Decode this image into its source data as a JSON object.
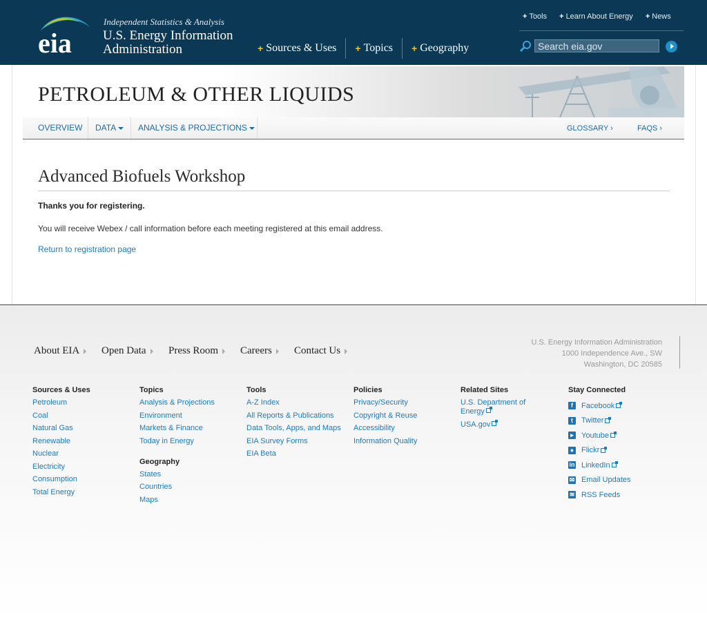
{
  "header": {
    "logo_text": "eia",
    "tagline": "Independent Statistics & Analysis",
    "agency_line1": "U.S. Energy Information",
    "agency_line2": "Administration",
    "main_nav": [
      {
        "label": "Sources & Uses"
      },
      {
        "label": "Topics"
      },
      {
        "label": "Geography"
      }
    ],
    "util_nav": [
      {
        "label": "Tools"
      },
      {
        "label": "Learn About Energy"
      },
      {
        "label": "News"
      }
    ],
    "plus": "+",
    "search_placeholder": "Search eia.gov"
  },
  "banner": {
    "title": "PETROLEUM & OTHER LIQUIDS"
  },
  "subnav": {
    "overview": "OVERVIEW",
    "data": "DATA",
    "analysis": "ANALYSIS & PROJECTIONS",
    "glossary": "GLOSSARY ›",
    "faqs": "FAQS ›"
  },
  "content": {
    "title": "Advanced Biofuels Workshop",
    "thanks": "Thanks you for registering.",
    "message": "You will receive Webex / call information before each meeting registered at this email address.",
    "return_link": "Return to registration page"
  },
  "footer": {
    "nav": [
      "About EIA",
      "Open Data",
      "Press Room",
      "Careers",
      "Contact Us"
    ],
    "address": [
      "U.S. Energy Information Administration",
      "1000 Independence Ave., SW",
      "Washington, DC 20585"
    ],
    "columns": {
      "sources": {
        "heading": "Sources & Uses",
        "links": [
          "Petroleum",
          "Coal",
          "Natural Gas",
          "Renewable",
          "Nuclear",
          "Electricity",
          "Consumption",
          "Total Energy"
        ]
      },
      "topics": {
        "heading": "Topics",
        "links": [
          "Analysis & Projections",
          "Environment",
          "Markets & Finance",
          "Today in Energy"
        ]
      },
      "geography": {
        "heading": "Geography",
        "links": [
          "States",
          "Countries",
          "Maps"
        ]
      },
      "tools": {
        "heading": "Tools",
        "links": [
          "A-Z Index",
          "All Reports & Publications",
          "Data Tools, Apps, and Maps",
          "EIA Survey Forms",
          "EIA Beta"
        ]
      },
      "policies": {
        "heading": "Policies",
        "links": [
          "Privacy/Security",
          "Copyright & Reuse",
          "Accessibility",
          "Information Quality"
        ]
      },
      "related": {
        "heading": "Related Sites",
        "links": [
          "U.S. Department of Energy",
          "USA.gov"
        ]
      },
      "stay": {
        "heading": "Stay Connected",
        "links": [
          {
            "label": "Facebook",
            "icon": "facebook-icon"
          },
          {
            "label": "Twitter",
            "icon": "twitter-icon"
          },
          {
            "label": "Youtube",
            "icon": "youtube-icon"
          },
          {
            "label": "Flickr",
            "icon": "flickr-icon"
          },
          {
            "label": "LinkedIn",
            "icon": "linkedin-icon"
          },
          {
            "label": "Email Updates",
            "icon": "email-icon"
          },
          {
            "label": "RSS Feeds",
            "icon": "rss-icon"
          }
        ]
      }
    }
  },
  "colors": {
    "header_bg": "#0a3855",
    "link": "#1b7ac2",
    "accent_plus": "#f2c318"
  }
}
